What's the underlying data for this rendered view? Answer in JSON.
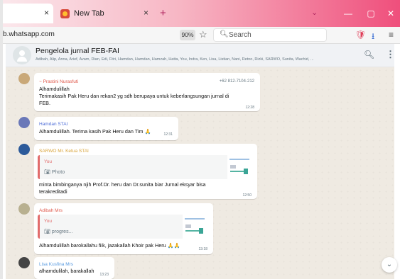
{
  "browser": {
    "tabs": [
      {
        "label": ""
      },
      {
        "label": "New Tab"
      }
    ],
    "close_glyph": "×",
    "new_tab_glyph": "+",
    "tabs_menu_glyph": "⌄",
    "window_buttons": {
      "minimize": "—",
      "maximize": "▢",
      "close": "✕"
    },
    "url": "b.whatsapp.com",
    "zoom": "90%",
    "search_placeholder": "Search",
    "icons": [
      "star-icon",
      "search-icon",
      "pocket-icon",
      "download-icon",
      "hamburger-menu-icon"
    ]
  },
  "chat": {
    "group_name": "Pengelola jurnal FEB-FAI",
    "members": "Adibah, Alip, Anna, Arief, Avam, Dian, Edi, Fitri, Hamdan, Hamdan, Hamzah, Hatta, You, Indra, Ken, Lisa, Listian, Nani, Retno, Rizki, SARWO, Sunita, Wachid, ...",
    "messages": [
      {
        "sender": "~ Prastini Nurasfuti",
        "phone": "+62 812-7104-212",
        "lines": [
          "Alhamdulillah",
          "Terimakasih Pak Heru dan rekan2 yg sdh berupaya untuk keberlangsungan jurnal di",
          "FEB."
        ],
        "time": "12:28",
        "sender_color": "#e0584a"
      },
      {
        "sender": "Hamdan STAI",
        "lines": [
          "Alhamdulillah. Terima kasih Pak Heru dan Tim 🙏"
        ],
        "time": "12:31",
        "sender_color": "#4f6ed8"
      },
      {
        "sender": "SARWO Mr. Ketua STAI",
        "quote_name": "You",
        "quote_text": "Photo",
        "lines": [
          "minta bimbinganya njih Prof.Dr. heru dan Dr.sunita biar Jurnal eksyar bisa",
          "terakreditadi"
        ],
        "time": "12:50",
        "sender_color": "#d8a43a"
      },
      {
        "sender": "Adibah Mrs",
        "quote_name": "You",
        "quote_text": "progres...",
        "lines": [
          "Alhamdulillah barokallahu fiik, jazakallah Khoir pak Heru 🙏🙏"
        ],
        "time": "13:18",
        "sender_color": "#e0584a"
      },
      {
        "sender": "Lisa Kusfina Mrs",
        "lines": [
          "alhamdulilah, barakallah"
        ],
        "time": "13:23",
        "sender_color": "#5a9be0"
      }
    ],
    "scroll_down_glyph": "⌄"
  },
  "colors": {
    "chat_bg": "#efeae2",
    "tab_gradient_end": "#ef4f7c",
    "quote_accent": "#e26c6c"
  }
}
